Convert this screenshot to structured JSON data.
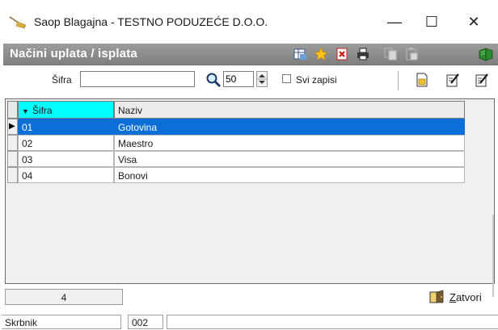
{
  "window": {
    "title": "Saop Blagajna - TESTNO PODUZEĆE D.O.O.",
    "minimize_glyph": "—",
    "maximize_glyph": "☐",
    "close_glyph": "✕",
    "app_icon": "broom-icon"
  },
  "toolbar": {
    "title": "Načini uplata / isplata",
    "icons": [
      "grid-settings-icon",
      "favorite-star-icon",
      "delete-icon",
      "print-icon",
      "copy-icon",
      "paste-icon",
      "book-icon"
    ]
  },
  "filter": {
    "code_label": "Šifra",
    "code_value": "",
    "records_value": "50",
    "all_records_label": "Svi zapisi",
    "all_records_checked": false,
    "actions": [
      "new-record-icon",
      "edit-icon",
      "edit-all-icon"
    ]
  },
  "grid": {
    "columns": [
      "Šifra",
      "Naziv"
    ],
    "sort_indicator": "▼",
    "row_pointer": "▶",
    "selected_index": 0,
    "rows": [
      {
        "sifra": "01",
        "naziv": "Gotovina"
      },
      {
        "sifra": "02",
        "naziv": "Maestro"
      },
      {
        "sifra": "03",
        "naziv": "Visa"
      },
      {
        "sifra": "04",
        "naziv": "Bonovi"
      }
    ]
  },
  "footer": {
    "record_count": "4",
    "close_label_underlined": "Z",
    "close_label_rest": "atvori"
  },
  "status": {
    "user": "Skrbnik",
    "code": "002"
  },
  "colors": {
    "selection": "#0c6fd8",
    "sorted_header": "#00ffff",
    "toolbar": "#8c8c8c"
  }
}
